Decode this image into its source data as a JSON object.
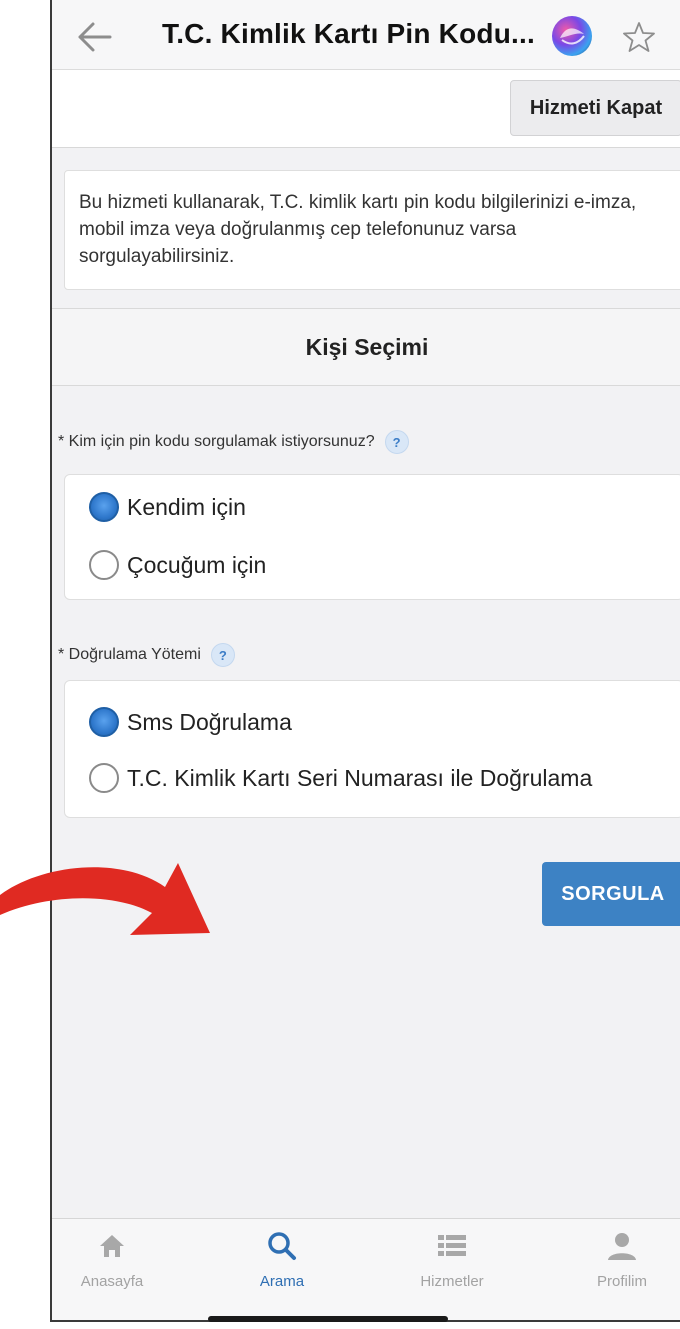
{
  "header": {
    "title": "T.C. Kimlik Kartı Pin Kodu...",
    "back_icon": "arrow-left-icon",
    "assistant_icon": "siri-icon",
    "favorite_icon": "star-outline-icon"
  },
  "action_bar": {
    "close_label": "Hizmeti Kapat"
  },
  "info": {
    "text": "Bu hizmeti kullanarak, T.C. kimlik kartı pin kodu bilgilerinizi e-imza, mobil imza veya doğrulanmış cep telefonunuz varsa sorgulayabilirsiniz."
  },
  "section": {
    "title": "Kişi Seçimi"
  },
  "person_field": {
    "label": "* Kim için pin kodu sorgulamak istiyorsunuz?",
    "help": "?",
    "options": [
      {
        "label": "Kendim için",
        "checked": true
      },
      {
        "label": "Çocuğum için",
        "checked": false
      }
    ]
  },
  "verification_field": {
    "label": "* Doğrulama Yötemi",
    "help": "?",
    "options": [
      {
        "label": "Sms Doğrulama",
        "checked": true
      },
      {
        "label": "T.C. Kimlik Kartı Seri Numarası ile Doğrulama",
        "checked": false
      }
    ]
  },
  "query_button": {
    "label": "SORGULA"
  },
  "bottom_nav": {
    "items": [
      {
        "label": "Anasayfa",
        "icon": "home-icon",
        "active": false
      },
      {
        "label": "Arama",
        "icon": "search-icon",
        "active": true
      },
      {
        "label": "Hizmetler",
        "icon": "list-icon",
        "active": false
      },
      {
        "label": "Profilim",
        "icon": "user-icon",
        "active": false
      }
    ]
  },
  "colors": {
    "primary": "#3d82c4",
    "active_nav": "#2f6fb3",
    "inactive_nav": "#a3a3a3",
    "annotation_arrow": "#e02a22"
  }
}
